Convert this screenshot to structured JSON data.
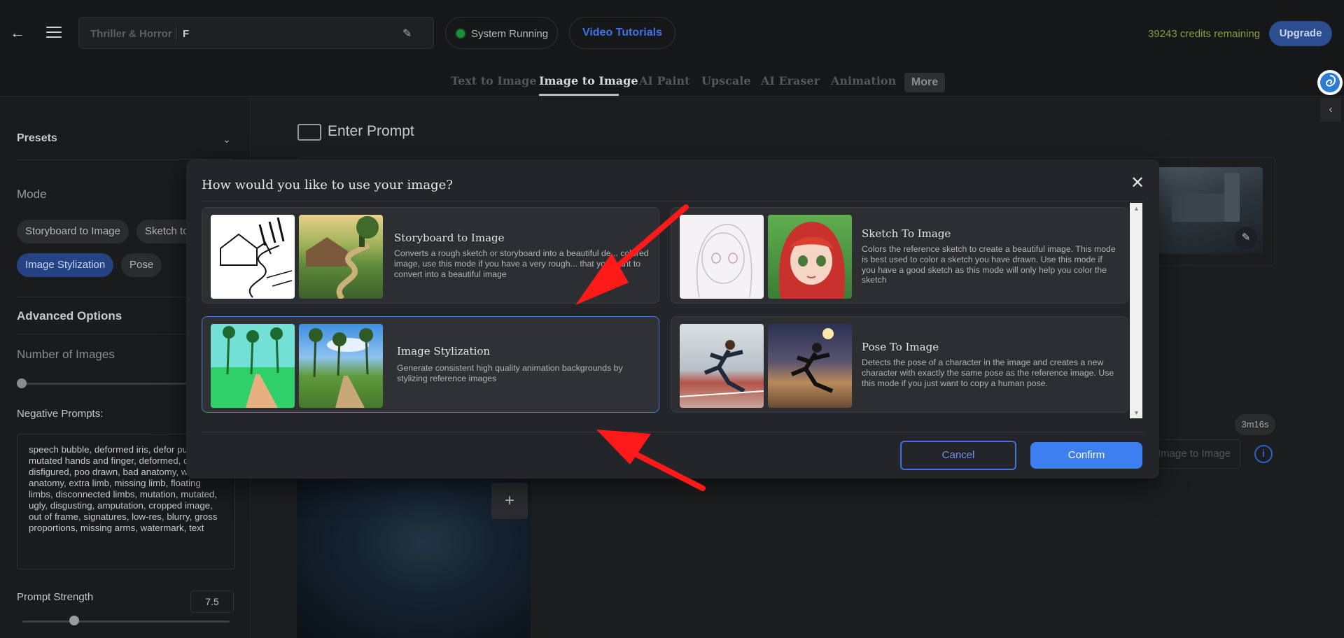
{
  "header": {
    "project_genre": "Thriller & Horror",
    "project_name": "F",
    "status": "System Running",
    "tutorials": "Video Tutorials",
    "credits": "39243 credits remaining",
    "upgrade": "Upgrade"
  },
  "tabs": [
    {
      "label": "Text to Image"
    },
    {
      "label": "Image to Image"
    },
    {
      "label": "AI Paint"
    },
    {
      "label": "Upscale"
    },
    {
      "label": "AI Eraser"
    },
    {
      "label": "Animation"
    },
    {
      "label": "More"
    }
  ],
  "active_tab": "Image to Image",
  "sidebar": {
    "presets": "Presets",
    "mode": "Mode",
    "modes": [
      {
        "label": "Storyboard to Image"
      },
      {
        "label": "Sketch to"
      },
      {
        "label": "Image Stylization"
      },
      {
        "label": "Pose"
      }
    ],
    "active_mode": "Image Stylization",
    "advanced": "Advanced Options",
    "num_images": "Number of Images",
    "negative_label": "Negative Prompts:",
    "negative_text": "speech bubble, deformed iris, defor pupils, mutated hands and finger, deformed, distorted, disfigured, poo drawn, bad anatomy, wrong anatomy, extra limb, missing limb, floating limbs, disconnected limbs, mutation, mutated, ugly, disgusting, amputation, cropped image, out of frame, signatures, low-res, blurry, gross proportions, missing arms, watermark, text",
    "strength_label": "Prompt Strength",
    "strength_value": "7.5"
  },
  "main": {
    "enter_prompt": "Enter Prompt",
    "timer": "3m16s",
    "generate_ghost": "Image to Image",
    "info": "i"
  },
  "modal": {
    "title": "How would you like to use your image?",
    "close": "✕",
    "options": [
      {
        "title": "Storyboard to Image",
        "description": "Converts a rough sketch or storyboard into a beautiful de... colored image, use this mode if you have a very rough... that you want to convert into a beautiful image"
      },
      {
        "title": "Sketch To Image",
        "description": "Colors the reference sketch to create a beautiful image. This mode is best used to color a sketch you have drawn. Use this mode if you have a good sketch as this mode will only help you color the sketch"
      },
      {
        "title": "Image Stylization",
        "description": "Generate consistent high quality animation backgrounds by stylizing reference images"
      },
      {
        "title": "Pose To Image",
        "description": "Detects the pose of a character in the image and creates a new character with exactly the same pose as the reference image. Use this mode if you just want to copy a human pose."
      }
    ],
    "selected": "Image Stylization",
    "cancel": "Cancel",
    "confirm": "Confirm"
  },
  "colors": {
    "accent": "#3e7ff0",
    "arrow": "#ff1a1a",
    "status_green": "#1d8f3a",
    "credits_olive": "#8d9a3a"
  },
  "icons": [
    "back-arrow-icon",
    "hamburger-menu-icon",
    "pencil-icon",
    "chevron-down-icon",
    "close-icon",
    "plus-icon",
    "info-icon",
    "chevron-left-icon"
  ]
}
